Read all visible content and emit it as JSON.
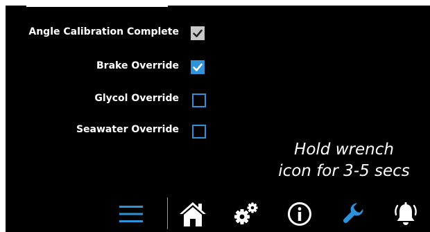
{
  "settings": {
    "items": [
      {
        "label": "Angle Calibration Complete",
        "state": "checked-disabled"
      },
      {
        "label": "Brake Override",
        "state": "checked"
      },
      {
        "label": "Glycol Override",
        "state": "unchecked"
      },
      {
        "label": "Seawater Override",
        "state": "unchecked"
      }
    ]
  },
  "hint": {
    "line1": "Hold wrench",
    "line2": "icon for 3-5 secs"
  },
  "nav": {
    "items": [
      {
        "icon": "menu-icon",
        "active": true
      },
      {
        "icon": "home-icon",
        "active": false
      },
      {
        "icon": "gears-icon",
        "active": false
      },
      {
        "icon": "info-icon",
        "active": false
      },
      {
        "icon": "wrench-icon",
        "active": true
      },
      {
        "icon": "alarm-bell-icon",
        "active": false
      }
    ]
  },
  "colors": {
    "background": "#000000",
    "accent": "#2f93d9",
    "text": "#ffffff",
    "disabled_check": "#c8c8c8"
  }
}
